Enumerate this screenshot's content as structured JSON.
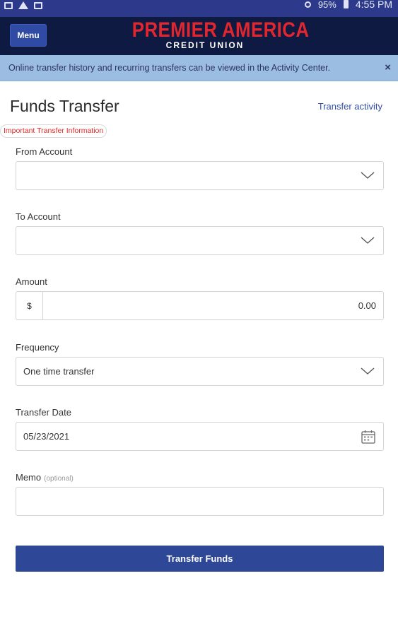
{
  "status_bar": {
    "time": "4:55 PM",
    "battery": "95%"
  },
  "header": {
    "menu_label": "Menu",
    "logo_main": "PREMIER AMERICA",
    "logo_sub": "CREDIT UNION"
  },
  "banner": {
    "text": "Online transfer history and recurring transfers can be viewed in the Activity Center.",
    "close": "×"
  },
  "page": {
    "title": "Funds Transfer",
    "activity_link": "Transfer activity",
    "important_link": "Important Transfer Information"
  },
  "form": {
    "from_account": {
      "label": "From Account",
      "value": ""
    },
    "to_account": {
      "label": "To Account",
      "value": ""
    },
    "amount": {
      "label": "Amount",
      "currency": "$",
      "value": "0.00"
    },
    "frequency": {
      "label": "Frequency",
      "value": "One time transfer"
    },
    "transfer_date": {
      "label": "Transfer Date",
      "value": "05/23/2021"
    },
    "memo": {
      "label": "Memo",
      "optional": "(optional)",
      "value": ""
    },
    "submit_label": "Transfer Funds"
  },
  "colors": {
    "header_bg": "#0e1a42",
    "brand_red": "#e0262e",
    "banner_bg": "#9cbde2",
    "button_bg": "#2f4797",
    "link": "#3450a8"
  },
  "icons": {
    "dropdown": "chevron-down-icon",
    "calendar": "calendar-icon",
    "close": "close-icon"
  }
}
